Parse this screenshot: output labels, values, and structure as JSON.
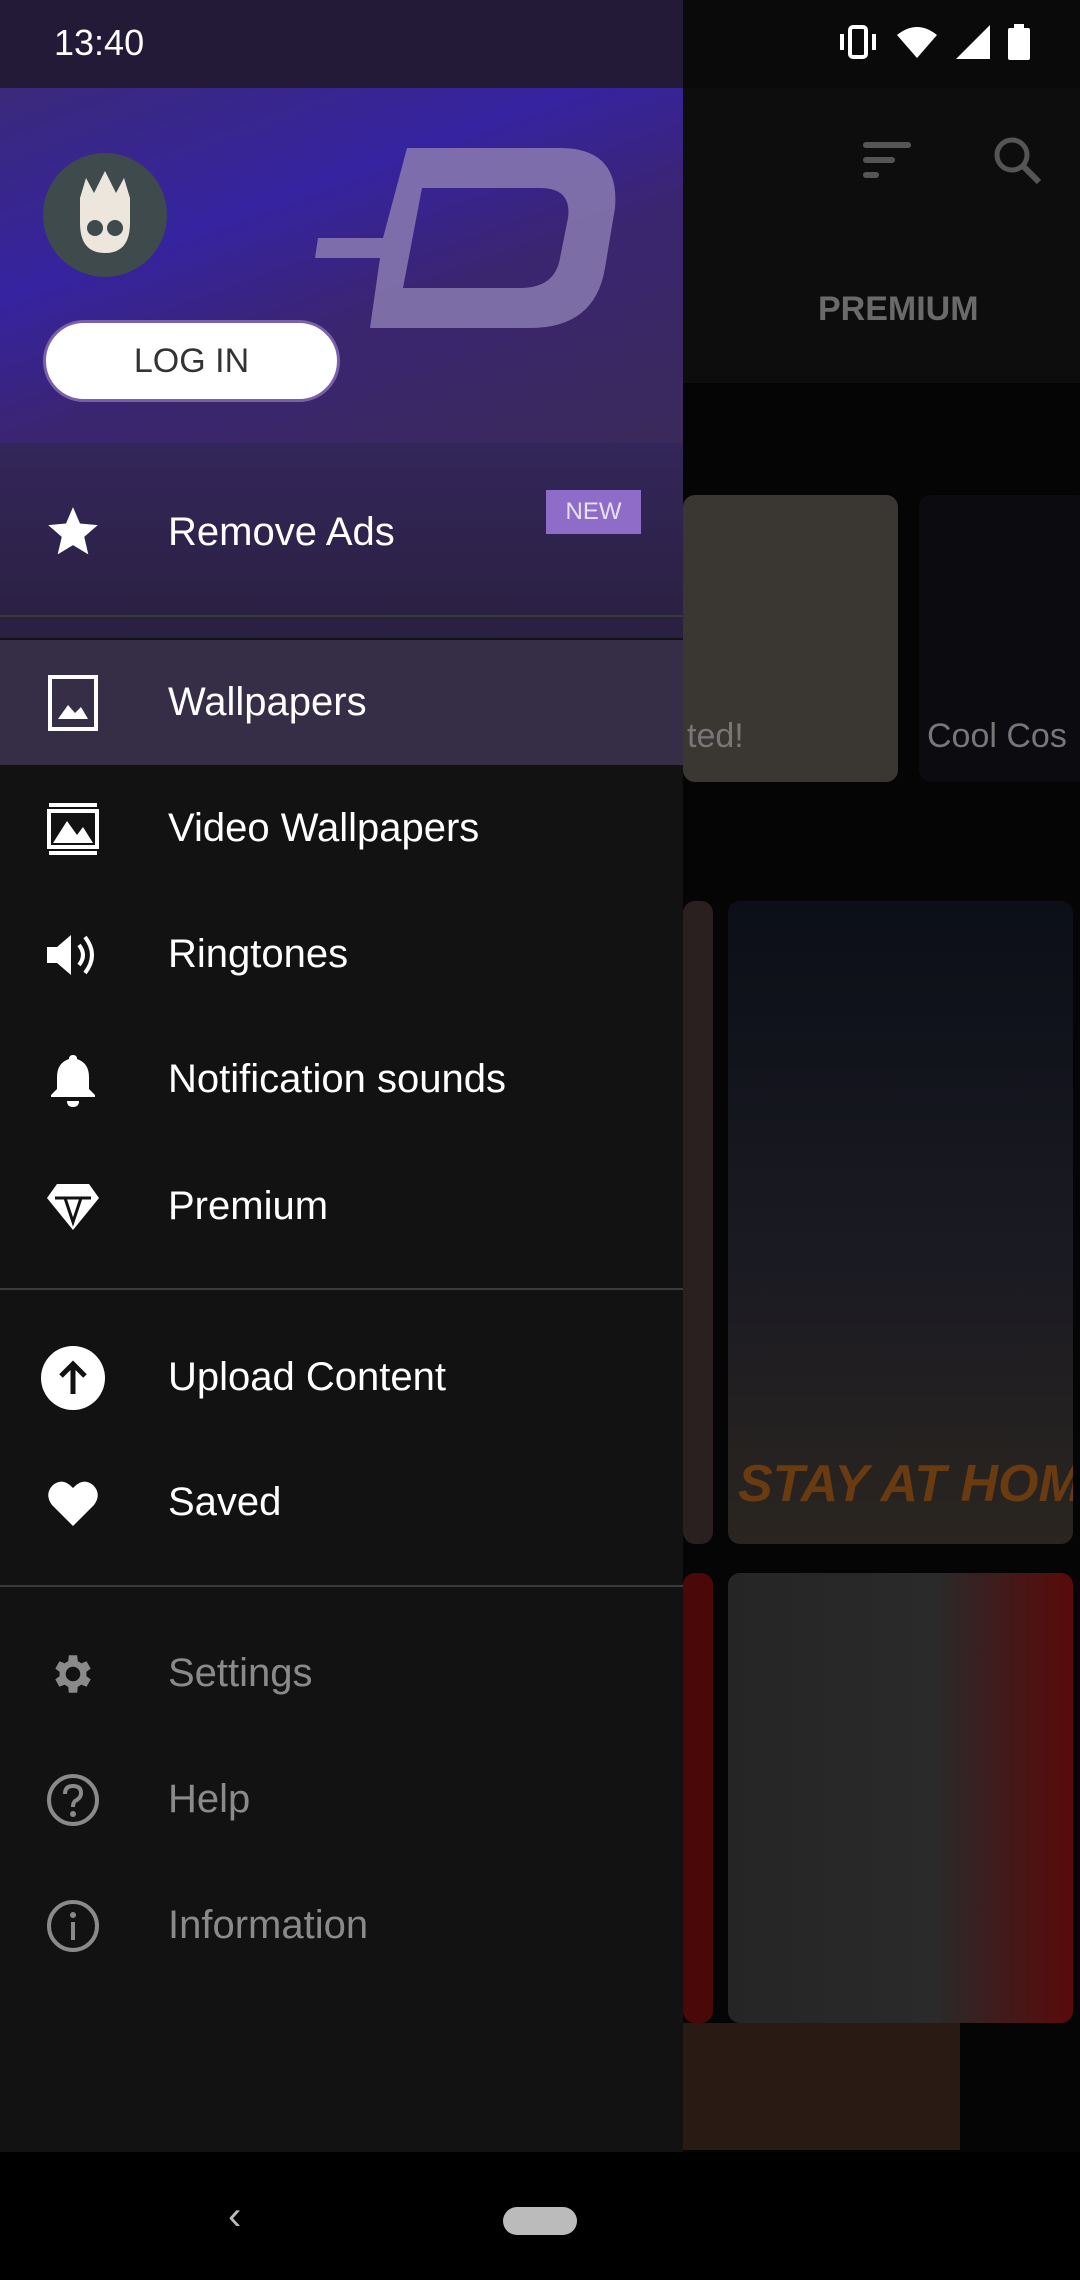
{
  "status_bar": {
    "time": "13:40",
    "icons": [
      "vibrate-icon",
      "wifi-icon",
      "signal-icon",
      "battery-icon"
    ]
  },
  "background": {
    "tab_label": "PREMIUM",
    "card_caption_1": "ted!",
    "card_caption_2": "Cool Cos",
    "wallpaper_text": "STAY AT HOME"
  },
  "drawer": {
    "login_label": "LOG IN",
    "remove_ads": {
      "label": "Remove Ads",
      "badge": "NEW",
      "icon": "star-icon"
    },
    "primary": [
      {
        "label": "Wallpapers",
        "icon": "image-icon",
        "selected": true
      },
      {
        "label": "Video Wallpapers",
        "icon": "video-wallpaper-icon"
      },
      {
        "label": "Ringtones",
        "icon": "speaker-icon"
      },
      {
        "label": "Notification sounds",
        "icon": "bell-icon"
      },
      {
        "label": "Premium",
        "icon": "diamond-icon"
      }
    ],
    "secondary": [
      {
        "label": "Upload Content",
        "icon": "upload-icon"
      },
      {
        "label": "Saved",
        "icon": "heart-icon"
      }
    ],
    "tertiary": [
      {
        "label": "Settings",
        "icon": "gear-icon"
      },
      {
        "label": "Help",
        "icon": "help-icon"
      },
      {
        "label": "Information",
        "icon": "info-icon"
      }
    ]
  },
  "colors": {
    "accent": "#8e6cc8",
    "drawer_bg": "#121212"
  }
}
